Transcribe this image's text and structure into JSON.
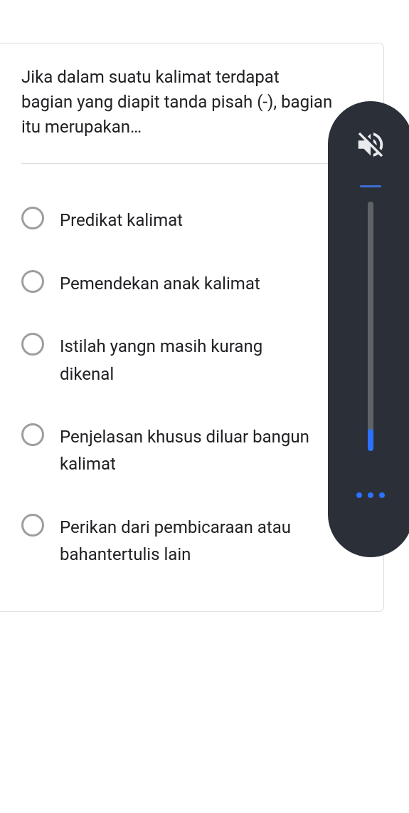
{
  "question": "Jika dalam suatu kalimat terdapat bagian yang diapit tanda pisah (-), bagian itu merupakan…",
  "options": [
    {
      "label": "Predikat kalimat",
      "selected": false
    },
    {
      "label": "Pemendekan anak kalimat",
      "selected": false
    },
    {
      "label": "Istilah yangn masih kurang dikenal",
      "selected": false
    },
    {
      "label": "Penjelasan khusus diluar bangun kalimat",
      "selected": false
    },
    {
      "label": "Perikan dari pembicaraan atau bahantertulis lain",
      "selected": false
    }
  ],
  "volume": {
    "muted": true,
    "level_percent": 9
  }
}
